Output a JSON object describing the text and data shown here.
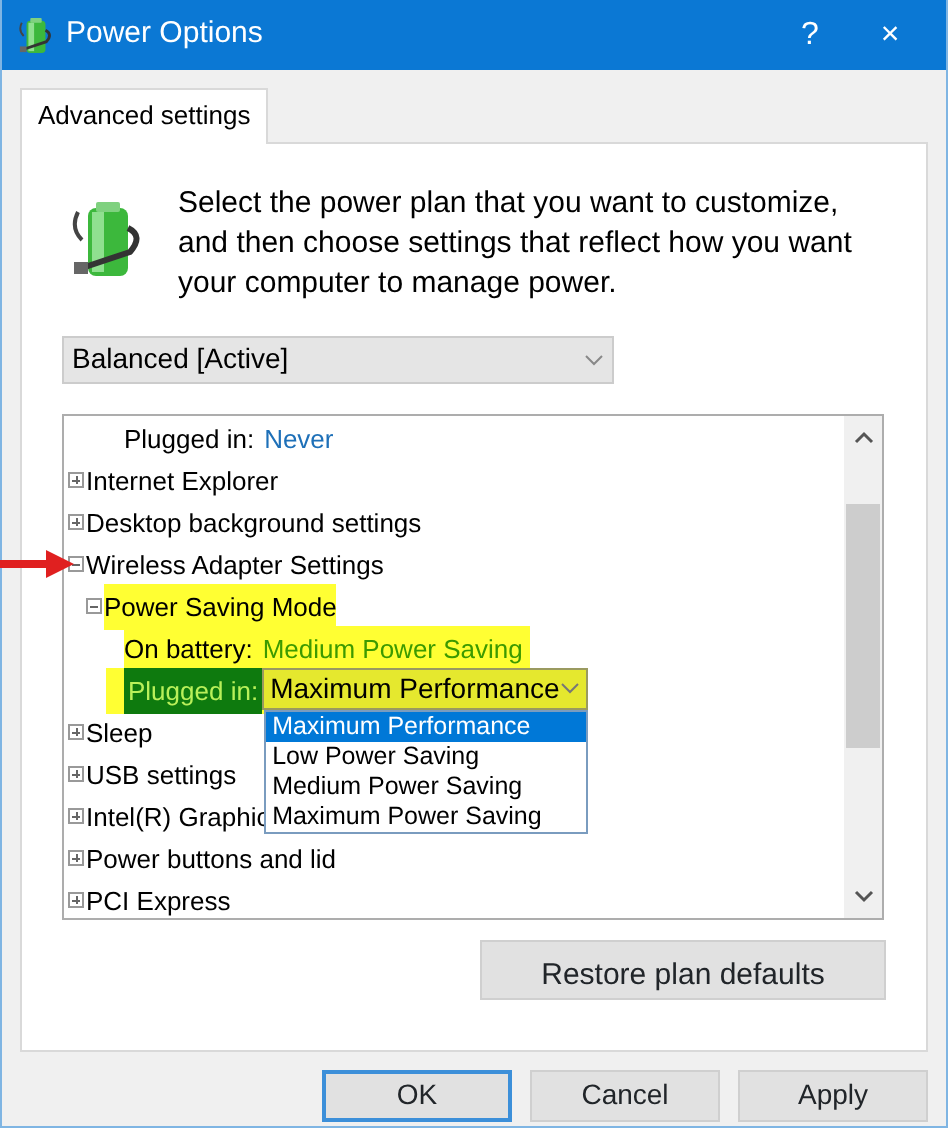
{
  "window": {
    "title": "Power Options",
    "help": "?",
    "close": "×"
  },
  "tabs": [
    {
      "label": "Advanced settings",
      "selected": true
    }
  ],
  "description": "Select the power plan that you want to customize, and then choose settings that reflect how you want your computer to manage power.",
  "plan_select": {
    "value": "Balanced [Active]"
  },
  "tree": [
    {
      "kind": "setting",
      "label": "Plugged in:",
      "value": "Never"
    },
    {
      "kind": "group",
      "label": "Internet Explorer",
      "expanded": false
    },
    {
      "kind": "group",
      "label": "Desktop background settings",
      "expanded": false
    },
    {
      "kind": "group",
      "label": "Wireless Adapter Settings",
      "expanded": true,
      "pointed": true,
      "children": [
        {
          "kind": "group",
          "label": "Power Saving Mode",
          "expanded": true,
          "highlighted": true,
          "children": [
            {
              "kind": "setting",
              "label": "On battery:",
              "value": "Medium Power Saving"
            },
            {
              "kind": "combo",
              "label": "Plugged in:",
              "value": "Maximum Performance",
              "open": true,
              "options": [
                {
                  "label": "Maximum Performance",
                  "selected": true
                },
                {
                  "label": "Low Power Saving",
                  "selected": false
                },
                {
                  "label": "Medium Power Saving",
                  "selected": false
                },
                {
                  "label": "Maximum Power Saving",
                  "selected": false
                }
              ]
            }
          ]
        }
      ]
    },
    {
      "kind": "group",
      "label": "Sleep",
      "expanded": false
    },
    {
      "kind": "group",
      "label": "USB settings",
      "expanded": false
    },
    {
      "kind": "group",
      "label": "Intel(R) Graphic",
      "expanded": false
    },
    {
      "kind": "group",
      "label": "Power buttons and lid",
      "expanded": false
    },
    {
      "kind": "group",
      "label": "PCI Express",
      "expanded": false
    }
  ],
  "restore_button": "Restore plan defaults",
  "buttons": [
    "OK",
    "Cancel",
    "Apply"
  ]
}
